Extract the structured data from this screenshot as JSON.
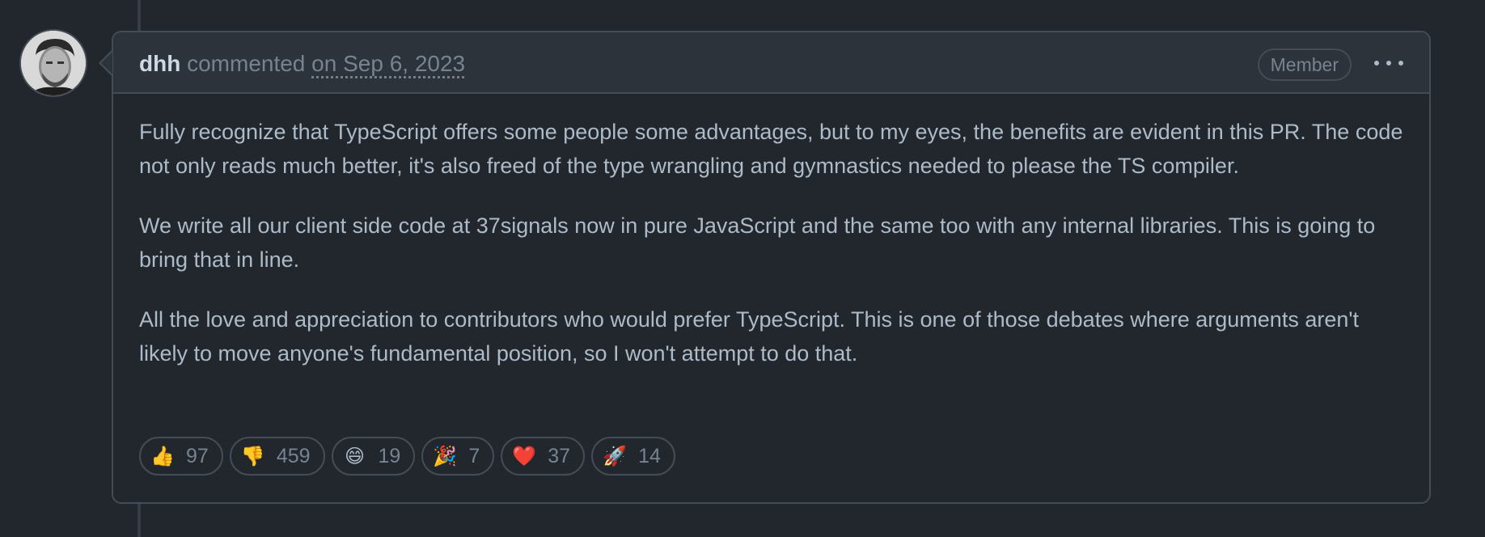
{
  "comment": {
    "author": "dhh",
    "verb": "commented",
    "date": "on Sep 6, 2023",
    "badge": "Member",
    "paragraphs": [
      "Fully recognize that TypeScript offers some people some advantages, but to my eyes, the benefits are evident in this PR. The code not only reads much better, it's also freed of the type wrangling and gymnastics needed to please the TS compiler.",
      "We write all our client side code at 37signals now in pure JavaScript and the same too with any internal libraries. This is going to bring that in line.",
      "All the love and appreciation to contributors who would prefer TypeScript. This is one of those debates where arguments aren't likely to move anyone's fundamental position, so I won't attempt to do that."
    ],
    "reactions": [
      {
        "icon": "thumbs-up-icon",
        "emoji": "👍",
        "count": "97"
      },
      {
        "icon": "thumbs-down-icon",
        "emoji": "👎",
        "count": "459"
      },
      {
        "icon": "laugh-icon",
        "emoji": "😄",
        "count": "19"
      },
      {
        "icon": "hooray-icon",
        "emoji": "🎉",
        "count": "7"
      },
      {
        "icon": "heart-icon",
        "emoji": "❤️",
        "count": "37"
      },
      {
        "icon": "rocket-icon",
        "emoji": "🚀",
        "count": "14"
      }
    ]
  },
  "colors": {
    "background": "#22272e",
    "header_background": "#2d333b",
    "border": "#444c56",
    "text": "#adbac7",
    "muted_text": "#768390",
    "author_text": "#cdd9e5"
  }
}
